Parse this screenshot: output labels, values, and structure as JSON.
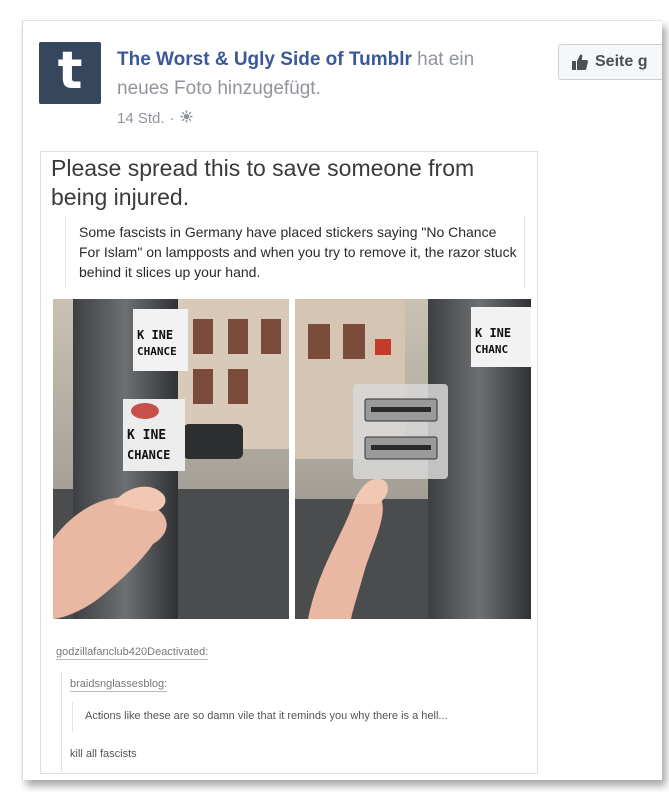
{
  "post": {
    "page_name": "The Worst & Ugly Side of Tumblr",
    "action_text": " hat ein neues Foto hinzugefügt.",
    "time": "14 Std.",
    "separator": "·",
    "audience_icon": "globe-icon",
    "logo_letter": "t",
    "like_page_label": "Seite g"
  },
  "image": {
    "headline": "Please spread this to save someone from being injured.",
    "quote": "Some fascists in Germany have placed stickers saying \"No Chance For Islam\" on lampposts and when you try to remove it, the razor stuck behind it slices up your hand.",
    "sticker_lines": [
      "K INE",
      "CHANCE"
    ],
    "sticker_lines_top": [
      "K INE",
      "CHANCE"
    ],
    "sticker_lines_right": [
      "K INE",
      "CHANC"
    ],
    "username1": "godzillafanclub420Deactivated:",
    "username2": "braidsnglassesblog:",
    "comment": "Actions like these are so damn vile that it reminds you why there is a hell...",
    "reply": "kill all fascists"
  },
  "colors": {
    "link_blue": "#3b5998",
    "meta_gray": "#90949c",
    "tumblr_navy": "#36465d"
  }
}
